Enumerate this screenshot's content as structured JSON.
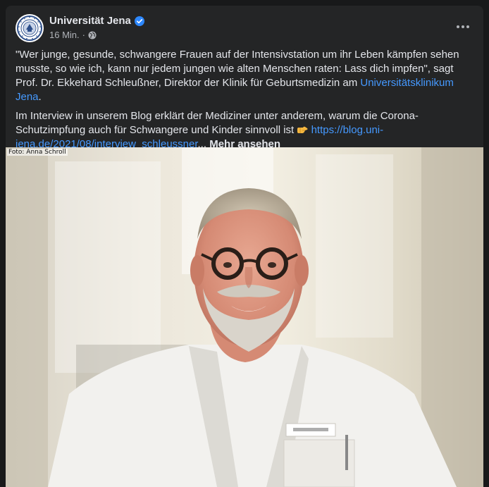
{
  "post": {
    "page_name": "Universität Jena",
    "time": "16 Min.",
    "dot": "·",
    "paragraph1_text": "\"Wer junge, gesunde, schwangere Frauen auf der Intensivstation um ihr Leben kämpfen sehen musste, so wie ich, kann nur jedem jungen wie alten Menschen raten: Lass dich impfen\", sagt Prof. Dr. Ekkehard Schleußner, Direktor der Klinik für Geburtsmedizin am ",
    "paragraph1_link": "Universitätsklinikum Jena",
    "paragraph1_end": ".",
    "paragraph2_text": "Im Interview in unserem Blog erklärt der Mediziner unter anderem, warum die Corona-Schutzimpfung auch für Schwangere und Kinder sinnvoll ist ",
    "paragraph2_link": "https://blog.uni-jena.de/2021/08/interview_schleussner",
    "ellipsis": "...",
    "see_more": "Mehr ansehen",
    "photo_credit": "Foto: Anna Schroll",
    "icons": {
      "avatar": "university-seal-icon",
      "verified": "verified-badge-icon",
      "audience": "globe-icon",
      "more": "more-options-icon",
      "emoji": "pointing-right-emoji"
    }
  },
  "colors": {
    "background": "#18191a",
    "card": "#242526",
    "text": "#e4e6eb",
    "secondary_text": "#b0b3b8",
    "link": "#4599ff",
    "verified": "#2d88ff"
  }
}
